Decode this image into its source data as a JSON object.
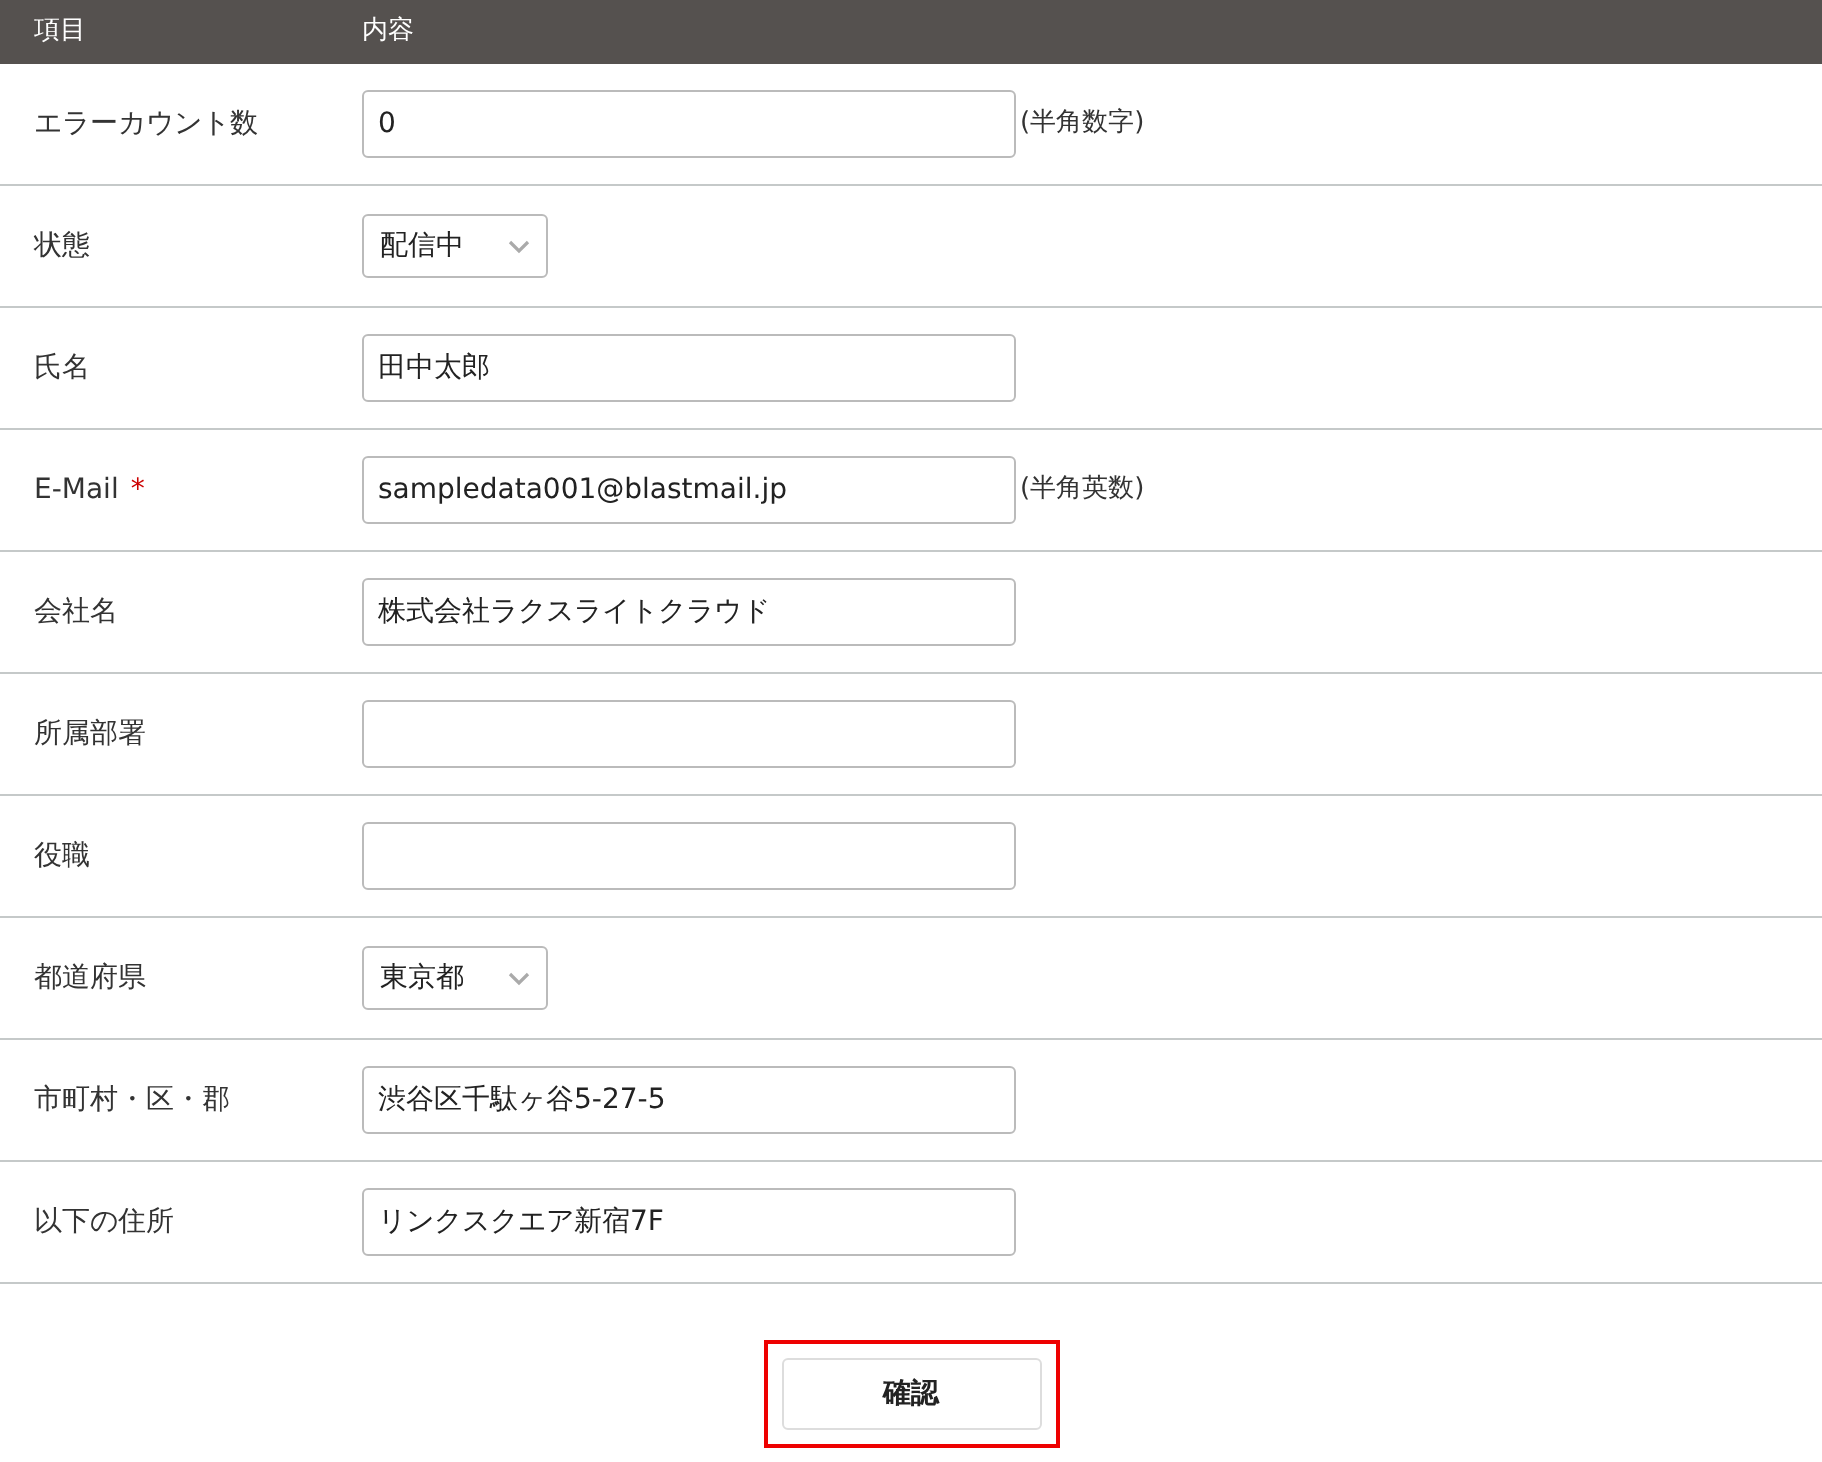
{
  "header": {
    "column_1": "項目",
    "column_2": "内容"
  },
  "rows": [
    {
      "label": "エラーカウント数",
      "kind": "text",
      "value": "0",
      "note": "(半角数字)"
    },
    {
      "label": "状態",
      "kind": "select",
      "value": "配信中"
    },
    {
      "label": "氏名",
      "kind": "text",
      "value": "田中太郎"
    },
    {
      "label": "E-Mail",
      "required_mark": "*",
      "kind": "text",
      "value": "sampledata001@blastmail.jp",
      "note": "(半角英数)"
    },
    {
      "label": "会社名",
      "kind": "text",
      "value": "株式会社ラクスライトクラウド"
    },
    {
      "label": "所属部署",
      "kind": "text"
    },
    {
      "label": "役職",
      "kind": "text"
    },
    {
      "label": "都道府県",
      "kind": "select",
      "value": "東京都"
    },
    {
      "label": "市町村・区・郡",
      "kind": "text",
      "value": "渋谷区千駄ヶ谷5-27-5"
    },
    {
      "label": "以下の住所",
      "kind": "text",
      "value": "リンクスクエア新宿7F"
    }
  ],
  "submit": {
    "label": "確認",
    "highlighted": true
  }
}
